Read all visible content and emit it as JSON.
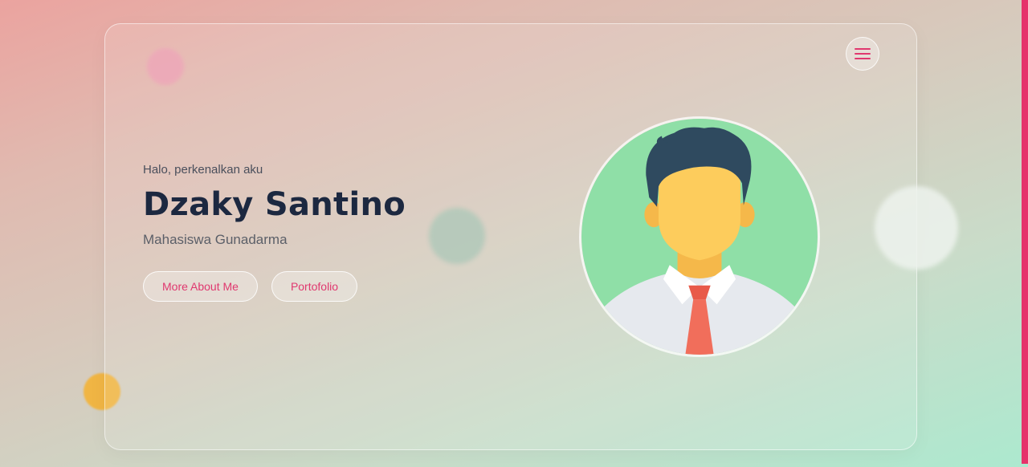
{
  "hero": {
    "greeting": "Halo, perkenalkan aku",
    "name": "Dzaky Santino",
    "subtitle": "Mahasiswa Gunadarma",
    "buttons": [
      {
        "label": "More About Me"
      },
      {
        "label": "Portofolio"
      }
    ]
  },
  "header": {
    "menu_icon": "hamburger-icon"
  },
  "avatar": {
    "icon": "person-avatar"
  },
  "colors": {
    "accent": "#e0386f",
    "heading": "#1c2840",
    "avatar_bg": "#8fdfa7",
    "skin": "#fdcc5c",
    "hair": "#2f4a5f",
    "tie": "#f16e5b"
  }
}
